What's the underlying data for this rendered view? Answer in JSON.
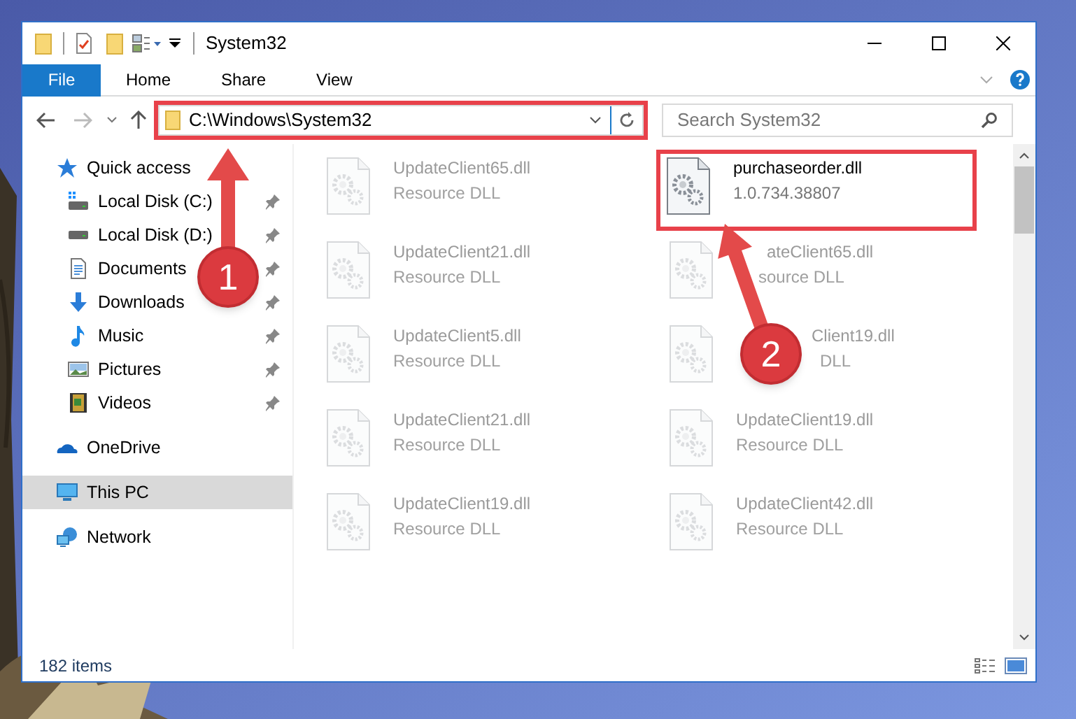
{
  "window": {
    "title": "System32"
  },
  "ribbon_tabs": [
    {
      "label": "File",
      "selected": true
    },
    {
      "label": "Home",
      "selected": false
    },
    {
      "label": "Share",
      "selected": false
    },
    {
      "label": "View",
      "selected": false
    }
  ],
  "address": {
    "path": "C:\\Windows\\System32",
    "highlighted": true
  },
  "search": {
    "placeholder": "Search System32"
  },
  "sidebar": {
    "items": [
      {
        "label": "Quick access",
        "selected": false,
        "children": [
          {
            "label": "Local Disk (C:)",
            "selected": false,
            "pinned": true
          },
          {
            "label": "Local Disk (D:)",
            "selected": false,
            "pinned": true
          },
          {
            "label": "Documents",
            "selected": false,
            "pinned": true
          },
          {
            "label": "Downloads",
            "selected": false,
            "pinned": true
          },
          {
            "label": "Music",
            "selected": false,
            "pinned": true
          },
          {
            "label": "Pictures",
            "selected": false,
            "pinned": true
          },
          {
            "label": "Videos",
            "selected": false,
            "pinned": true
          }
        ]
      },
      {
        "label": "OneDrive",
        "selected": false
      },
      {
        "label": "This PC",
        "selected": true
      },
      {
        "label": "Network",
        "selected": false
      }
    ]
  },
  "files": [
    {
      "name": "UpdateClient65.dll",
      "detail": "Resource DLL",
      "dimmed": true,
      "highlighted": false
    },
    {
      "name": "purchaseorder.dll",
      "detail": "1.0.734.38807",
      "dimmed": false,
      "highlighted": true
    },
    {
      "name": "UpdateClient21.dll",
      "detail": "Resource DLL",
      "dimmed": true,
      "highlighted": false
    },
    {
      "name": "ateClient65.dll",
      "detail": "source DLL",
      "dimmed": true,
      "highlighted": false
    },
    {
      "name": "UpdateClient5.dll",
      "detail": "Resource DLL",
      "dimmed": true,
      "highlighted": false
    },
    {
      "name": "Client19.dll",
      "detail": "DLL",
      "dimmed": true,
      "highlighted": false
    },
    {
      "name": "UpdateClient21.dll",
      "detail": "Resource DLL",
      "dimmed": true,
      "highlighted": false
    },
    {
      "name": "UpdateClient19.dll",
      "detail": "Resource DLL",
      "dimmed": true,
      "highlighted": false
    },
    {
      "name": "UpdateClient19.dll",
      "detail": "Resource DLL",
      "dimmed": true,
      "highlighted": false
    },
    {
      "name": "UpdateClient42.dll",
      "detail": "Resource DLL",
      "dimmed": true,
      "highlighted": false
    }
  ],
  "status_bar": {
    "count": "182 items"
  },
  "annotations": [
    {
      "label": "1"
    },
    {
      "label": "2"
    }
  ]
}
